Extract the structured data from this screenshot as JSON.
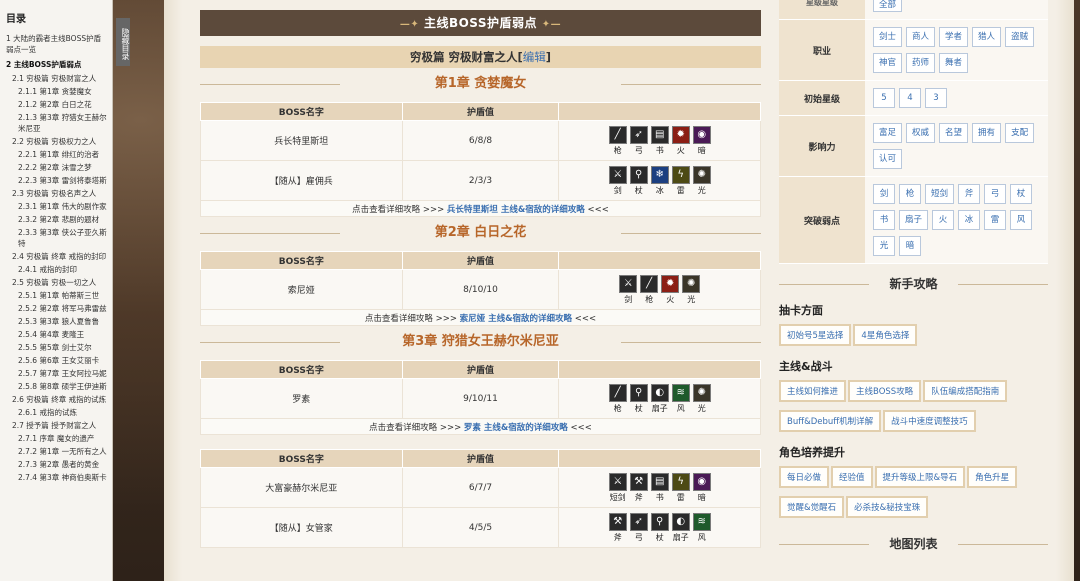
{
  "toc": {
    "title": "目录",
    "hide_tab": "隐藏目录",
    "items": [
      {
        "text": "1 大陆的霸者主线BOSS护盾弱点一览",
        "level": 1,
        "bold": false
      },
      {
        "text": "2 主线BOSS护盾弱点",
        "level": 1,
        "bold": true
      },
      {
        "text": "2.1 穷极篇 穷极财富之人",
        "level": 2,
        "bold": false
      },
      {
        "text": "2.1.1 第1章 贪婪魔女",
        "level": 3,
        "bold": false
      },
      {
        "text": "2.1.2 第2章 白日之花",
        "level": 3,
        "bold": false
      },
      {
        "text": "2.1.3 第3章 狩猎女王赫尔米尼亚",
        "level": 3,
        "bold": false
      },
      {
        "text": "2.2 穷极篇 穷极权力之人",
        "level": 2,
        "bold": false
      },
      {
        "text": "2.2.1 第1章 绯红的治者",
        "level": 3,
        "bold": false
      },
      {
        "text": "2.2.2 第2章 沫雪之梦",
        "level": 3,
        "bold": false
      },
      {
        "text": "2.2.3 第3章 雷剑将泰塔斯",
        "level": 3,
        "bold": false
      },
      {
        "text": "2.3 穷极篇 穷极名声之人",
        "level": 2,
        "bold": false
      },
      {
        "text": "2.3.1 第1章 伟大的剧作家",
        "level": 3,
        "bold": false
      },
      {
        "text": "2.3.2 第2章 悲剧的题材",
        "level": 3,
        "bold": false
      },
      {
        "text": "2.3.3 第3章 侠公子亚久斯特",
        "level": 3,
        "bold": false
      },
      {
        "text": "2.4 穷极篇 终章 戒指的封印",
        "level": 2,
        "bold": false
      },
      {
        "text": "2.4.1 戒指的封印",
        "level": 3,
        "bold": false
      },
      {
        "text": "2.5 穷极篇 穷极一切之人",
        "level": 2,
        "bold": false
      },
      {
        "text": "2.5.1 第1章 帕蒂斯三世",
        "level": 3,
        "bold": false
      },
      {
        "text": "2.5.2 第2章 将军马弗雷兹",
        "level": 3,
        "bold": false
      },
      {
        "text": "2.5.3 第3章 狼人夏鲁鲁",
        "level": 3,
        "bold": false
      },
      {
        "text": "2.5.4 第4章 麦隆王",
        "level": 3,
        "bold": false
      },
      {
        "text": "2.5.5 第5章 剑士艾尔",
        "level": 3,
        "bold": false
      },
      {
        "text": "2.5.6 第6章 王女艾丽卡",
        "level": 3,
        "bold": false
      },
      {
        "text": "2.5.7 第7章 王女阿拉马妮",
        "level": 3,
        "bold": false
      },
      {
        "text": "2.5.8 第8章 硕学王伊迪斯",
        "level": 3,
        "bold": false
      },
      {
        "text": "2.6 穷极篇 终章 戒指的试炼",
        "level": 2,
        "bold": false
      },
      {
        "text": "2.6.1 戒指的试炼",
        "level": 3,
        "bold": false
      },
      {
        "text": "2.7 授予篇 授予财富之人",
        "level": 2,
        "bold": false
      },
      {
        "text": "2.7.1 序章 魔女的遗产",
        "level": 3,
        "bold": false
      },
      {
        "text": "2.7.2 第1章 一无所有之人",
        "level": 3,
        "bold": false
      },
      {
        "text": "2.7.3 第2章 愚者的黄金",
        "level": 3,
        "bold": false
      },
      {
        "text": "2.7.4 第3章 神商伯奥斯卡",
        "level": 3,
        "bold": false
      }
    ]
  },
  "main": {
    "banner": "主线BOSS护盾弱点",
    "banner_deco_left": "—✦",
    "banner_deco_right": "✦—",
    "sub_title": "穷极篇 穷极财富之人",
    "edit_link": "编辑",
    "col_name": "BOSS名字",
    "col_shield": "护盾值",
    "link_prefix": "点击查看详细攻略 >>> ",
    "link_suffix": " <<<",
    "chapters": [
      {
        "title": "第1章 贪婪魔女",
        "rows": [
          {
            "name": "兵长特里斯坦",
            "shield": "6/8/8",
            "weak": [
              {
                "glyph": "╱",
                "lbl": "枪",
                "cls": ""
              },
              {
                "glyph": "➶",
                "lbl": "弓",
                "cls": ""
              },
              {
                "glyph": "▤",
                "lbl": "书",
                "cls": ""
              },
              {
                "glyph": "✹",
                "lbl": "火",
                "cls": "fire"
              },
              {
                "glyph": "◉",
                "lbl": "暗",
                "cls": "dark"
              }
            ]
          },
          {
            "name": "【随从】雇佣兵",
            "shield": "2/3/3",
            "weak": [
              {
                "glyph": "⚔",
                "lbl": "剑",
                "cls": ""
              },
              {
                "glyph": "⚲",
                "lbl": "杖",
                "cls": ""
              },
              {
                "glyph": "❄",
                "lbl": "冰",
                "cls": "ice"
              },
              {
                "glyph": "ϟ",
                "lbl": "雷",
                "cls": "thunder"
              },
              {
                "glyph": "✺",
                "lbl": "光",
                "cls": "light"
              }
            ]
          }
        ],
        "link": "兵长特里斯坦 主线&宿敌的详细攻略"
      },
      {
        "title": "第2章 白日之花",
        "rows": [
          {
            "name": "索尼娅",
            "shield": "8/10/10",
            "weak": [
              {
                "glyph": "⚔",
                "lbl": "剑",
                "cls": ""
              },
              {
                "glyph": "╱",
                "lbl": "枪",
                "cls": ""
              },
              {
                "glyph": "✹",
                "lbl": "火",
                "cls": "fire"
              },
              {
                "glyph": "✺",
                "lbl": "光",
                "cls": "light"
              }
            ]
          }
        ],
        "link": "索尼娅 主线&宿敌的详细攻略"
      },
      {
        "title": "第3章 狩猎女王赫尔米尼亚",
        "rows": [
          {
            "name": "罗素",
            "shield": "9/10/11",
            "weak": [
              {
                "glyph": "╱",
                "lbl": "枪",
                "cls": ""
              },
              {
                "glyph": "⚲",
                "lbl": "杖",
                "cls": ""
              },
              {
                "glyph": "◐",
                "lbl": "扇子",
                "cls": ""
              },
              {
                "glyph": "≋",
                "lbl": "风",
                "cls": "wind"
              },
              {
                "glyph": "✺",
                "lbl": "光",
                "cls": "light"
              }
            ]
          }
        ],
        "link": "罗素 主线&宿敌的详细攻略"
      }
    ],
    "chapter4_rows": [
      {
        "name": "大富豪赫尔米尼亚",
        "shield": "6/7/7",
        "weak": [
          {
            "glyph": "⚔",
            "lbl": "短剑",
            "cls": ""
          },
          {
            "glyph": "⚒",
            "lbl": "斧",
            "cls": ""
          },
          {
            "glyph": "▤",
            "lbl": "书",
            "cls": ""
          },
          {
            "glyph": "ϟ",
            "lbl": "雷",
            "cls": "thunder"
          },
          {
            "glyph": "◉",
            "lbl": "暗",
            "cls": "dark"
          }
        ]
      },
      {
        "name": "【随从】女管家",
        "shield": "4/5/5",
        "weak": [
          {
            "glyph": "⚒",
            "lbl": "斧",
            "cls": ""
          },
          {
            "glyph": "➶",
            "lbl": "弓",
            "cls": ""
          },
          {
            "glyph": "⚲",
            "lbl": "杖",
            "cls": ""
          },
          {
            "glyph": "◐",
            "lbl": "扇子",
            "cls": ""
          },
          {
            "glyph": "≋",
            "lbl": "风",
            "cls": "wind"
          }
        ]
      }
    ]
  },
  "right": {
    "top_tag": "全部",
    "top_key": "星级星级",
    "info": [
      {
        "key": "职业",
        "tags": [
          "剑士",
          "商人",
          "学者",
          "猎人",
          "盗贼",
          "神官",
          "药师",
          "舞者"
        ]
      },
      {
        "key": "初始星级",
        "tags": [
          "5",
          "4",
          "3"
        ]
      },
      {
        "key": "影响力",
        "tags": [
          "富足",
          "权威",
          "名望",
          "拥有",
          "支配",
          "认可"
        ]
      },
      {
        "key": "突破弱点",
        "tags": [
          "剑",
          "枪",
          "短剑",
          "斧",
          "弓",
          "杖",
          "书",
          "扇子",
          "火",
          "冰",
          "雷",
          "风",
          "光",
          "暗"
        ]
      }
    ],
    "newbie_title": "新手攻略",
    "groups": [
      {
        "title": "抽卡方面",
        "buttons": [
          "初始号5星选择",
          "4星角色选择"
        ]
      },
      {
        "title": "主线&战斗",
        "buttons": [
          "主线如何推进",
          "主线BOSS攻略",
          "队伍编成搭配指南",
          "Buff&Debuff机制详解",
          "战斗中速度调整技巧"
        ]
      },
      {
        "title": "角色培养提升",
        "buttons": [
          "每日必做",
          "经验值",
          "提升等级上限&导石",
          "角色升星",
          "觉醒&觉醒石",
          "必杀技&秘技宝珠"
        ]
      }
    ],
    "map_title": "地图列表"
  }
}
